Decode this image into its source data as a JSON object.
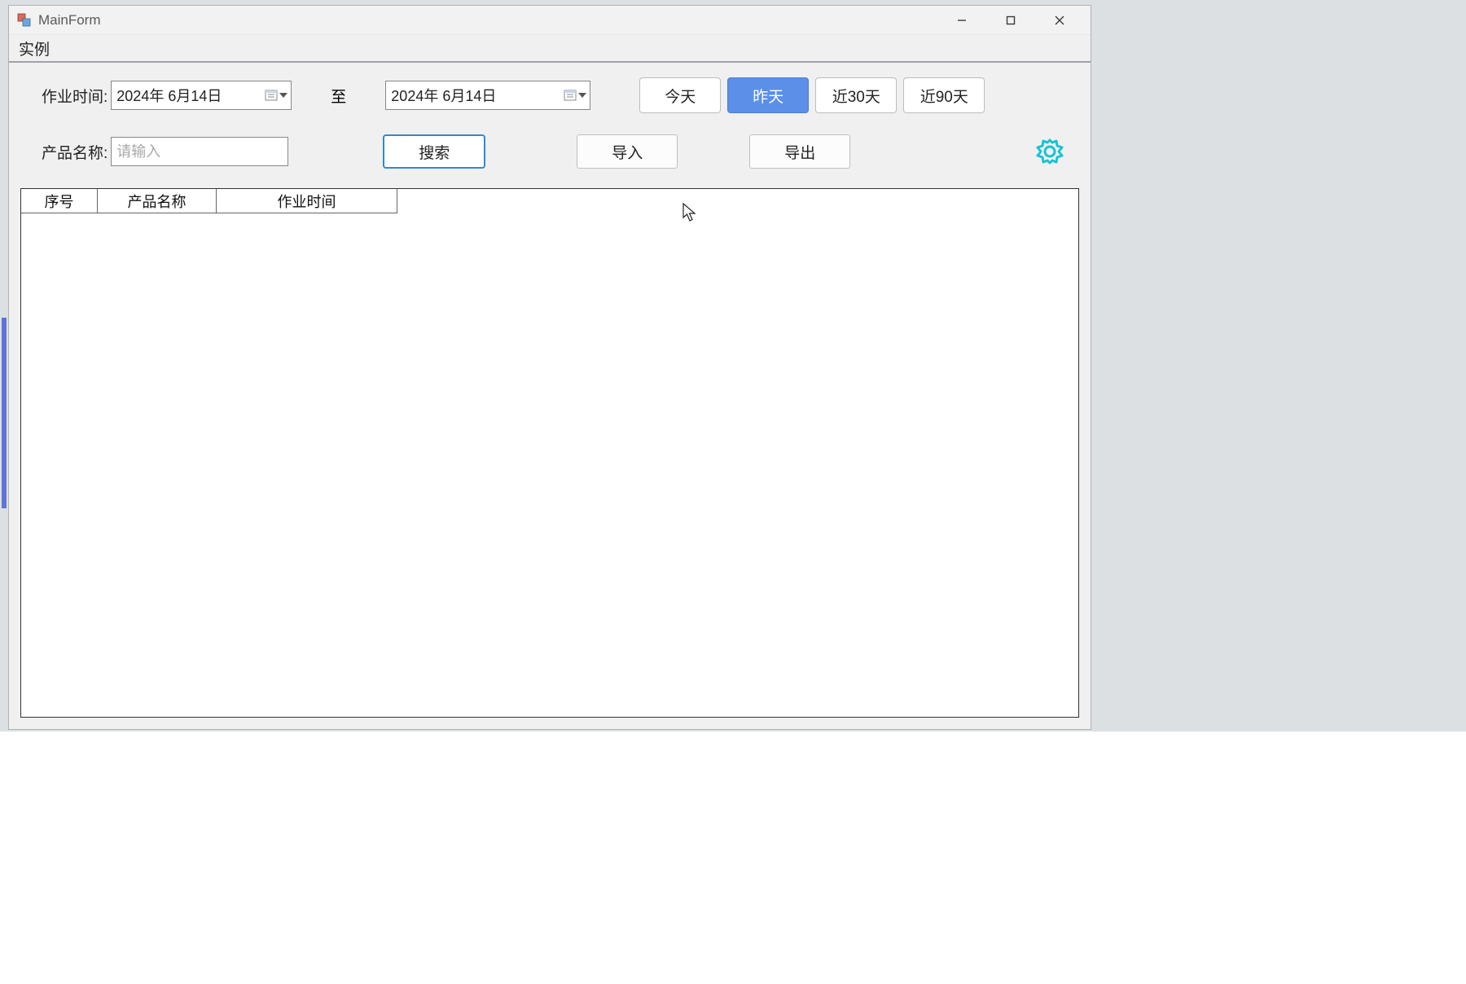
{
  "window": {
    "title": "MainForm"
  },
  "menu": {
    "instance": "实例"
  },
  "filters": {
    "date_label": "作业时间:",
    "date_start": "2024年 6月14日",
    "to_label": "至",
    "date_end": "2024年 6月14日",
    "quick": {
      "today": "今天",
      "yesterday": "昨天",
      "last30": "近30天",
      "last90": "近90天",
      "active": "yesterday"
    },
    "product_label": "产品名称:",
    "product_placeholder": "请输入",
    "product_value": ""
  },
  "buttons": {
    "search": "搜索",
    "import": "导入",
    "export": "导出"
  },
  "icons": {
    "settings": "settings-icon",
    "calendar": "calendar-icon"
  },
  "table": {
    "columns": [
      "序号",
      "产品名称",
      "作业时间"
    ],
    "rows": []
  },
  "colors": {
    "accent_blue": "#5b8fe8",
    "settings_teal": "#17c3d4",
    "search_border": "#2a8bd8"
  }
}
